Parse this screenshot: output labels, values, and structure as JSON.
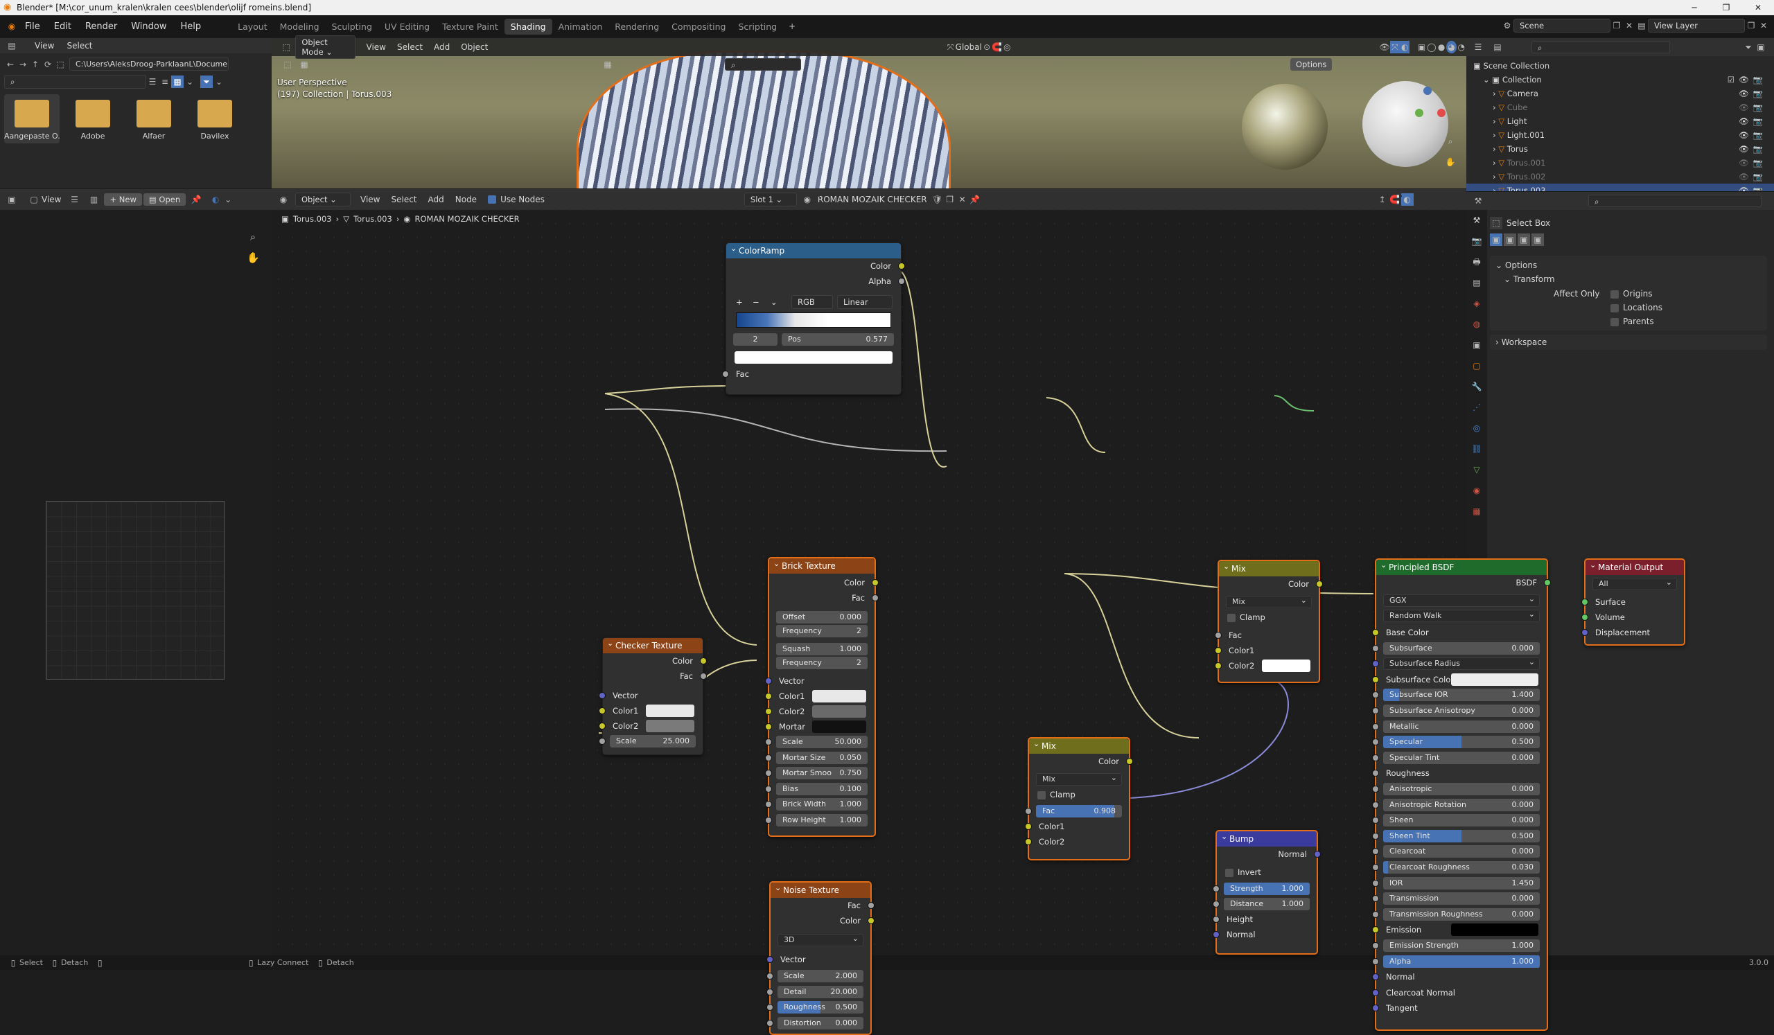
{
  "window": {
    "title": "Blender* [M:\\cor_unum_kralen\\kralen cees\\blender\\olijf romeins.blend]"
  },
  "menu": [
    "File",
    "Edit",
    "Render",
    "Window",
    "Help"
  ],
  "workspaces": [
    "Layout",
    "Modeling",
    "Sculpting",
    "UV Editing",
    "Texture Paint",
    "Shading",
    "Animation",
    "Rendering",
    "Compositing",
    "Scripting"
  ],
  "active_workspace": "Shading",
  "scene": {
    "name": "Scene",
    "view_layer": "View Layer"
  },
  "filebrowser": {
    "menu": [
      "View",
      "Select"
    ],
    "path": "C:\\Users\\AleksDroog-ParklaanL\\Documents\\",
    "folders": [
      "Aangepaste O...",
      "Adobe",
      "Alfaer",
      "Davilex"
    ]
  },
  "viewport": {
    "mode": "Object Mode",
    "menu": [
      "View",
      "Select",
      "Add",
      "Object"
    ],
    "transform": "Global",
    "options": "Options",
    "perspective": "User Perspective",
    "info": "(197) Collection | Torus.003"
  },
  "image_editor": {
    "view": "View",
    "new": "New",
    "open": "Open"
  },
  "node_editor": {
    "type": "Object",
    "menu": [
      "View",
      "Select",
      "Add",
      "Node"
    ],
    "use_nodes": "Use Nodes",
    "slot": "Slot 1",
    "material": "ROMAN MOZAIK CHECKER",
    "breadcrumb": [
      "Torus.003",
      "Torus.003",
      "ROMAN MOZAIK CHECKER"
    ]
  },
  "nodes": {
    "colorramp": {
      "title": "ColorRamp",
      "out": [
        "Color",
        "Alpha"
      ],
      "mode": "RGB",
      "interp": "Linear",
      "index": "2",
      "pos_label": "Pos",
      "pos_value": "0.577",
      "fac": "Fac"
    },
    "checker": {
      "title": "Checker Texture",
      "out": [
        "Color",
        "Fac"
      ],
      "inputs": [
        "Vector",
        "Color1",
        "Color2"
      ],
      "scale_label": "Scale",
      "scale_value": "25.000"
    },
    "brick": {
      "title": "Brick Texture",
      "out": [
        "Color",
        "Fac"
      ],
      "offset": [
        "Offset",
        "0.000"
      ],
      "frequency1": [
        "Frequency",
        "2"
      ],
      "squash": [
        "Squash",
        "1.000"
      ],
      "frequency2": [
        "Frequency",
        "2"
      ],
      "inputs": [
        "Vector",
        "Color1",
        "Color2",
        "Mortar"
      ],
      "params": [
        [
          "Scale",
          "50.000"
        ],
        [
          "Mortar Size",
          "0.050"
        ],
        [
          "Mortar Smoo",
          "0.750"
        ],
        [
          "Bias",
          "0.100"
        ],
        [
          "Brick Width",
          "1.000"
        ],
        [
          "Row Height",
          "1.000"
        ]
      ]
    },
    "noise": {
      "title": "Noise Texture",
      "out": [
        "Fac",
        "Color"
      ],
      "dim": "3D",
      "vector": "Vector",
      "params": [
        [
          "Scale",
          "2.000"
        ],
        [
          "Detail",
          "20.000"
        ],
        [
          "Roughness",
          "0.500"
        ],
        [
          "Distortion",
          "0.000"
        ]
      ]
    },
    "mix1": {
      "title": "Mix",
      "out": "Color",
      "blend": "Mix",
      "clamp": "Clamp",
      "inputs": [
        "Fac",
        "Color1",
        "Color2"
      ]
    },
    "mix2": {
      "title": "Mix",
      "out": "Color",
      "blend": "Mix",
      "clamp": "Clamp",
      "fac_label": "Fac",
      "fac_value": "0.908",
      "inputs": [
        "Color1",
        "Color2"
      ]
    },
    "bump": {
      "title": "Bump",
      "out": "Normal",
      "invert": "Invert",
      "strength": [
        "Strength",
        "1.000"
      ],
      "distance": [
        "Distance",
        "1.000"
      ],
      "inputs": [
        "Height",
        "Normal"
      ]
    },
    "bsdf": {
      "title": "Principled BSDF",
      "out": "BSDF",
      "dist": "GGX",
      "sss": "Random Walk",
      "rows": [
        {
          "t": "sock",
          "l": "Base Color"
        },
        {
          "t": "val",
          "l": "Subsurface",
          "v": "0.000"
        },
        {
          "t": "drop",
          "l": "Subsurface Radius"
        },
        {
          "t": "color",
          "l": "Subsurface Color"
        },
        {
          "t": "val",
          "l": "Subsurface IOR",
          "v": "1.400",
          "f": 0.1
        },
        {
          "t": "val",
          "l": "Subsurface Anisotropy",
          "v": "0.000"
        },
        {
          "t": "val",
          "l": "Metallic",
          "v": "0.000"
        },
        {
          "t": "val",
          "l": "Specular",
          "v": "0.500",
          "f": 0.5
        },
        {
          "t": "val",
          "l": "Specular Tint",
          "v": "0.000"
        },
        {
          "t": "sock",
          "l": "Roughness"
        },
        {
          "t": "val",
          "l": "Anisotropic",
          "v": "0.000"
        },
        {
          "t": "val",
          "l": "Anisotropic Rotation",
          "v": "0.000"
        },
        {
          "t": "val",
          "l": "Sheen",
          "v": "0.000"
        },
        {
          "t": "val",
          "l": "Sheen Tint",
          "v": "0.500",
          "f": 0.5
        },
        {
          "t": "val",
          "l": "Clearcoat",
          "v": "0.000"
        },
        {
          "t": "val",
          "l": "Clearcoat Roughness",
          "v": "0.030",
          "f": 0.03
        },
        {
          "t": "val",
          "l": "IOR",
          "v": "1.450"
        },
        {
          "t": "val",
          "l": "Transmission",
          "v": "0.000"
        },
        {
          "t": "val",
          "l": "Transmission Roughness",
          "v": "0.000"
        },
        {
          "t": "black",
          "l": "Emission"
        },
        {
          "t": "val",
          "l": "Emission Strength",
          "v": "1.000"
        },
        {
          "t": "val",
          "l": "Alpha",
          "v": "1.000",
          "f": 1.0
        },
        {
          "t": "sock",
          "l": "Normal"
        },
        {
          "t": "sock",
          "l": "Clearcoat Normal"
        },
        {
          "t": "sock",
          "l": "Tangent"
        }
      ]
    },
    "output": {
      "title": "Material Output",
      "target": "All",
      "inputs": [
        "Surface",
        "Volume",
        "Displacement"
      ]
    }
  },
  "outliner": {
    "root": "Scene Collection",
    "collection": "Collection",
    "items": [
      {
        "name": "Camera",
        "dim": false,
        "sel": false
      },
      {
        "name": "Cube",
        "dim": true,
        "sel": false
      },
      {
        "name": "Light",
        "dim": false,
        "sel": false
      },
      {
        "name": "Light.001",
        "dim": false,
        "sel": false
      },
      {
        "name": "Torus",
        "dim": false,
        "sel": false
      },
      {
        "name": "Torus.001",
        "dim": true,
        "sel": false
      },
      {
        "name": "Torus.002",
        "dim": true,
        "sel": false
      },
      {
        "name": "Torus.003",
        "dim": false,
        "sel": true
      }
    ]
  },
  "properties": {
    "tool": "Select Box",
    "options": "Options",
    "transform": "Transform",
    "affect_only": "Affect Only",
    "checks": [
      "Origins",
      "Locations",
      "Parents"
    ],
    "workspace": "Workspace"
  },
  "status": {
    "left": [
      "Select",
      "Detach"
    ],
    "center": [
      "Lazy Connect",
      "Detach"
    ],
    "version": "3.0.0"
  },
  "colors": {
    "accent": "#4772b3",
    "selected_border": "#e36e19",
    "shader_header": "#1f6b2b",
    "texture_header": "#8c4315",
    "color_header": "#6e6e1c",
    "vector_header": "#3b3b9e",
    "input_header": "#2b5f8a",
    "output_header": "#7a1f2b"
  }
}
